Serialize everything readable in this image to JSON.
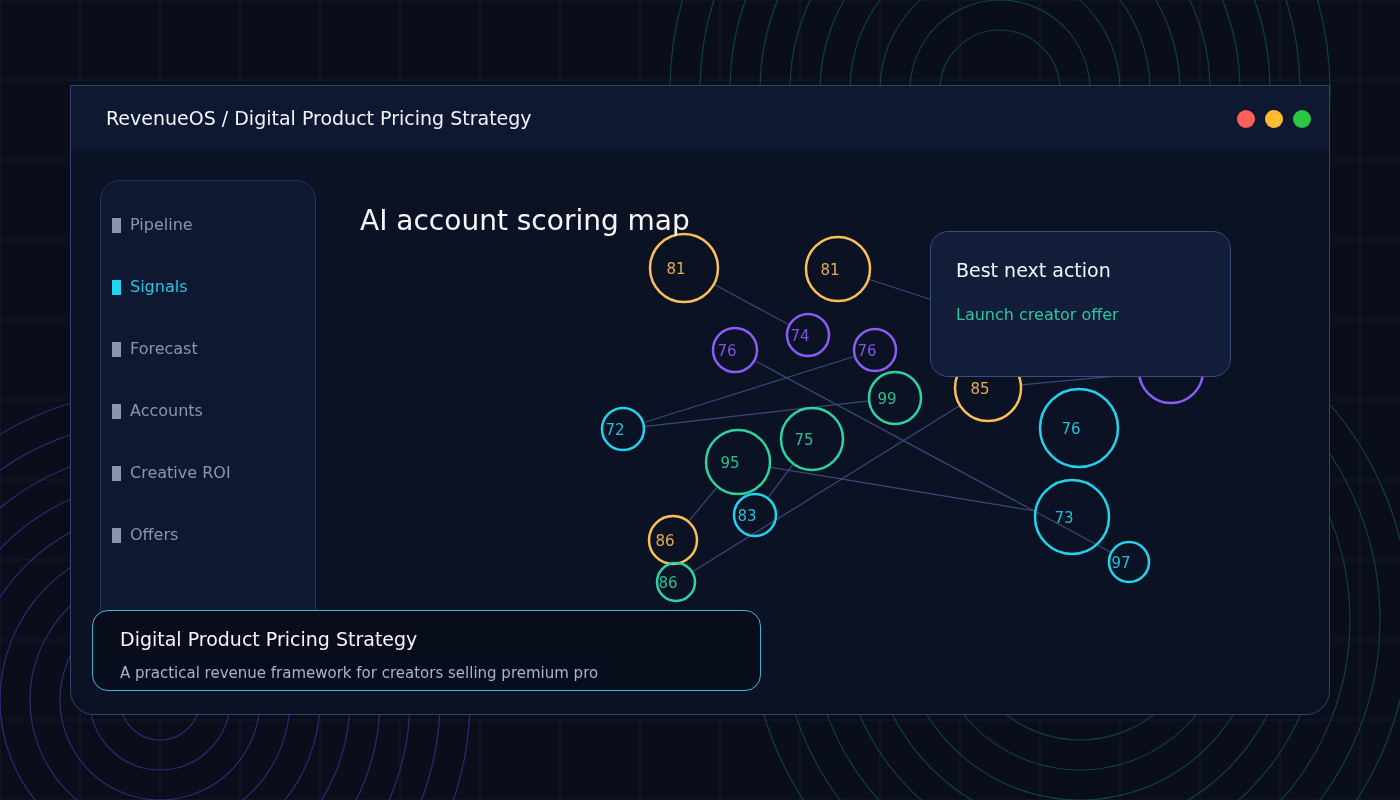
{
  "window": {
    "title": "RevenueOS / Digital Product Pricing Strategy"
  },
  "sidebar": {
    "items": [
      {
        "label": "Pipeline",
        "selected": false
      },
      {
        "label": "Signals",
        "selected": true
      },
      {
        "label": "Forecast",
        "selected": false
      },
      {
        "label": "Accounts",
        "selected": false
      },
      {
        "label": "Creative ROI",
        "selected": false
      },
      {
        "label": "Offers",
        "selected": false
      }
    ]
  },
  "map": {
    "title": "AI account scoring map",
    "bubbles": [
      {
        "value": "81",
        "color": "#fbbf57"
      },
      {
        "value": "81",
        "color": "#fbbf57"
      },
      {
        "value": "74",
        "color": "#8b5cf6"
      },
      {
        "value": "76",
        "color": "#8b5cf6"
      },
      {
        "value": "76",
        "color": "#8b5cf6"
      },
      {
        "value": "99",
        "color": "#2dd4a0"
      },
      {
        "value": "72",
        "color": "#22d3ee"
      },
      {
        "value": "75",
        "color": "#2dd4a0"
      },
      {
        "value": "95",
        "color": "#2dd4a0"
      },
      {
        "value": "83",
        "color": "#22d3ee"
      },
      {
        "value": "86",
        "color": "#fbbf57"
      },
      {
        "value": "86",
        "color": "#2dd4a0"
      },
      {
        "value": "85",
        "color": "#fbbf57"
      },
      {
        "value": "76",
        "color": "#22d3ee"
      },
      {
        "value": "73",
        "color": "#22d3ee"
      },
      {
        "value": "97",
        "color": "#22d3ee"
      },
      {
        "color": "#8b5cf6"
      }
    ]
  },
  "action_card": {
    "title": "Best next action",
    "action": "Launch creator offer"
  },
  "summary_card": {
    "title": "Digital Product Pricing Strategy",
    "description": "A practical revenue framework for creators selling premium pro"
  }
}
